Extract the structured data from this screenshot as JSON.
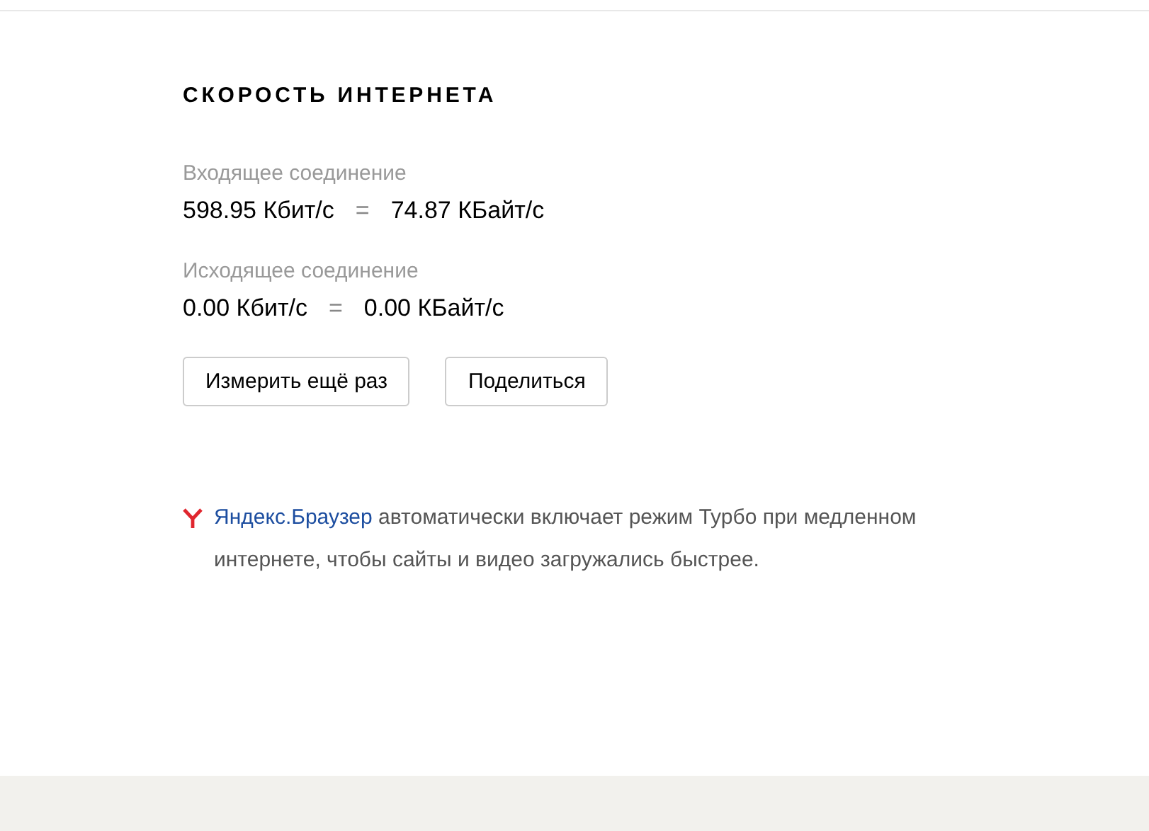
{
  "title": "СКОРОСТЬ ИНТЕРНЕТА",
  "measurements": [
    {
      "label": "Входящее соединение",
      "bits": "598.95 Кбит/с",
      "equals": "=",
      "bytes": "74.87 КБайт/с"
    },
    {
      "label": "Исходящее соединение",
      "bits": "0.00 Кбит/с",
      "equals": "=",
      "bytes": "0.00 КБайт/с"
    }
  ],
  "buttons": [
    "Измерить ещё раз",
    "Поделиться"
  ],
  "promo": {
    "link": "Яндекс.Браузер",
    "text": "автоматически включает режим Турбо при медленном интернете, чтобы сайты и видео загружались быстрее."
  }
}
